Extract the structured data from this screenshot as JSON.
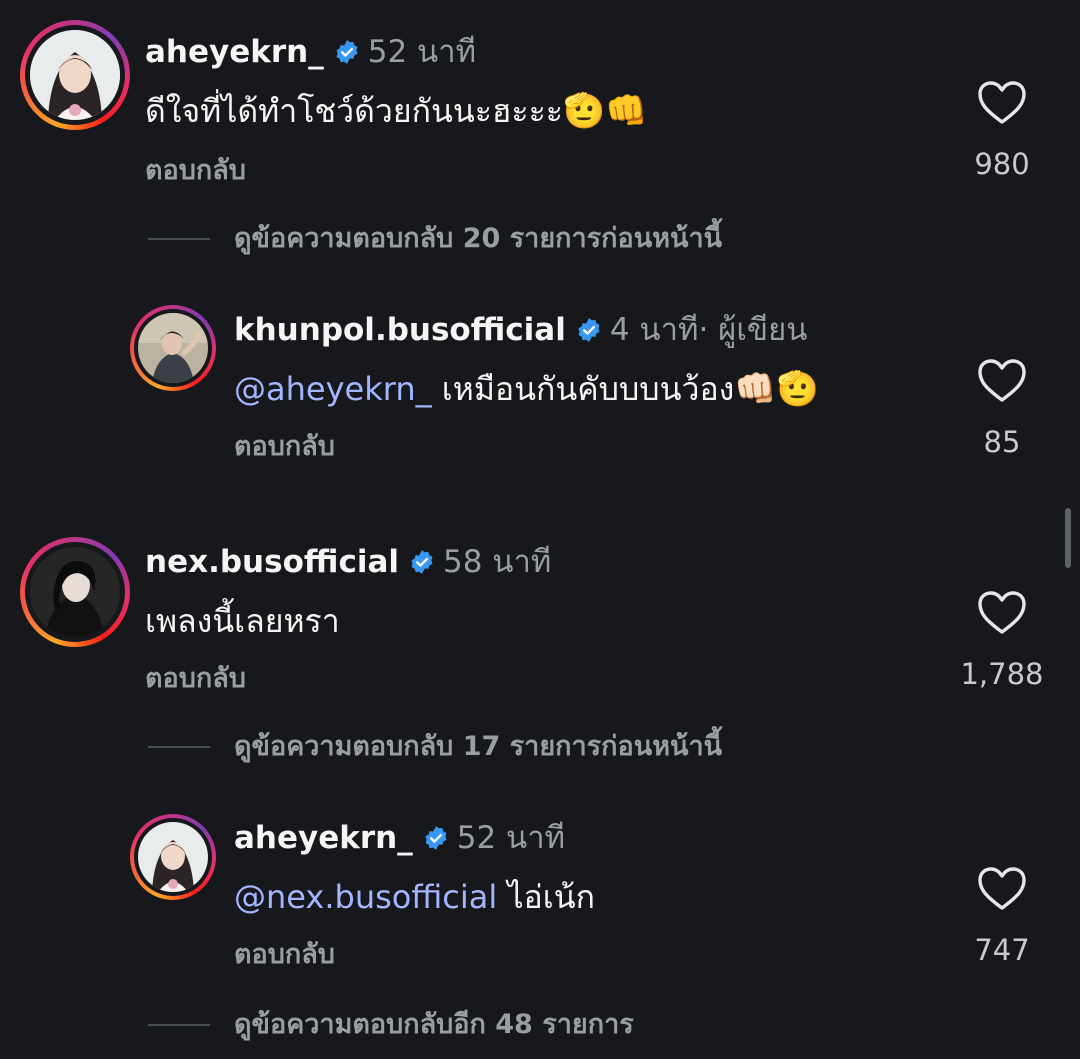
{
  "comments": [
    {
      "username": "aheyekrn_",
      "verified": true,
      "time": "52 นาที",
      "text": "ดีใจที่ได้ทำโชว์ด้วยกันนะฮะะะ",
      "emoji": "🫡👊",
      "reply_label": "ตอบกลับ",
      "like_count": "980",
      "view_replies": "ดูข้อความตอบกลับ 20 รายการก่อนหน้านี้",
      "reply": {
        "username": "khunpol.busofficial",
        "verified": true,
        "time": "4 นาที",
        "author_tag": " · ผู้เขียน",
        "mention": "@aheyekrn_",
        "text": " เหมือนกันคับบบนว้อง",
        "emoji": "👊🏻🫡",
        "reply_label": "ตอบกลับ",
        "like_count": "85"
      }
    },
    {
      "username": "nex.busofficial",
      "verified": true,
      "time": "58 นาที",
      "text": "เพลงนี้เลยหรา",
      "reply_label": "ตอบกลับ",
      "like_count": "1,788",
      "view_replies": "ดูข้อความตอบกลับ 17 รายการก่อนหน้านี้",
      "reply": {
        "username": "aheyekrn_",
        "verified": true,
        "time": "52 นาที",
        "mention": "@nex.busofficial",
        "text": " ไอ่เน้ก",
        "reply_label": "ตอบกลับ",
        "like_count": "747"
      },
      "view_more_replies": "ดูข้อความตอบกลับอีก 48 รายการ"
    }
  ],
  "colors": {
    "background": "#16181b",
    "mention": "#a3b5ff",
    "verified": "#3897f0",
    "secondary_text": "#9a9da3"
  },
  "icons": {
    "verified": "verified-badge-icon",
    "like": "heart-outline-icon"
  }
}
